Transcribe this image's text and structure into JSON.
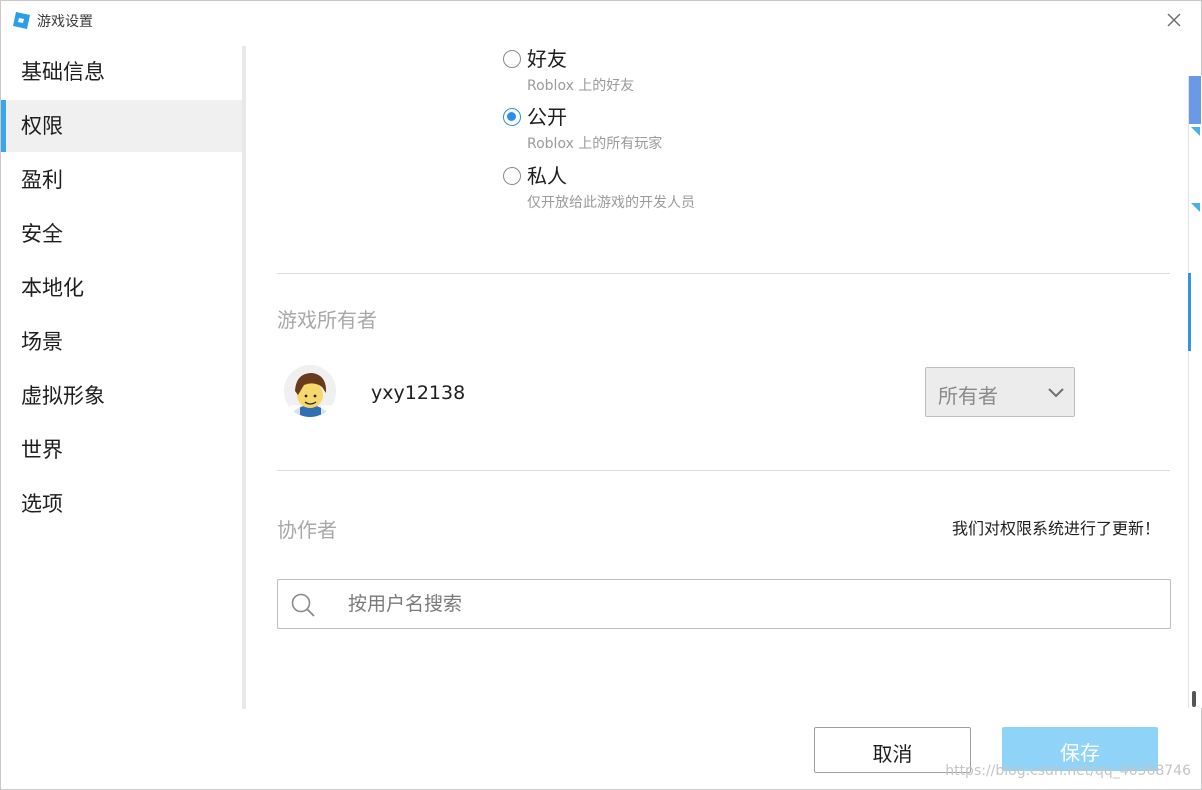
{
  "window": {
    "title": "游戏设置"
  },
  "sidebar": {
    "items": [
      {
        "label": "基础信息"
      },
      {
        "label": "权限",
        "active": true
      },
      {
        "label": "盈利"
      },
      {
        "label": "安全"
      },
      {
        "label": "本地化"
      },
      {
        "label": "场景"
      },
      {
        "label": "虚拟形象"
      },
      {
        "label": "世界"
      },
      {
        "label": "选项"
      }
    ]
  },
  "permissions": {
    "access_options": [
      {
        "label": "好友",
        "description": "Roblox 上的好友",
        "selected": false
      },
      {
        "label": "公开",
        "description": "Roblox 上的所有玩家",
        "selected": true
      },
      {
        "label": "私人",
        "description": "仅开放给此游戏的开发人员",
        "selected": false
      }
    ],
    "owner_section": {
      "title": "游戏所有者",
      "owner_name": "yxy12138",
      "role_value": "所有者"
    },
    "collaborators_section": {
      "title": "协作者",
      "update_note": "我们对权限系统进行了更新！",
      "search_placeholder": "按用户名搜索"
    }
  },
  "footer": {
    "cancel_label": "取消",
    "save_label": "保存",
    "watermark": "https://blog.csdn.net/qq_46368746"
  },
  "colors": {
    "accent": "#3aa6e9",
    "radio_checked": "#2b8ee8",
    "save_button": "#8fd4f8"
  }
}
